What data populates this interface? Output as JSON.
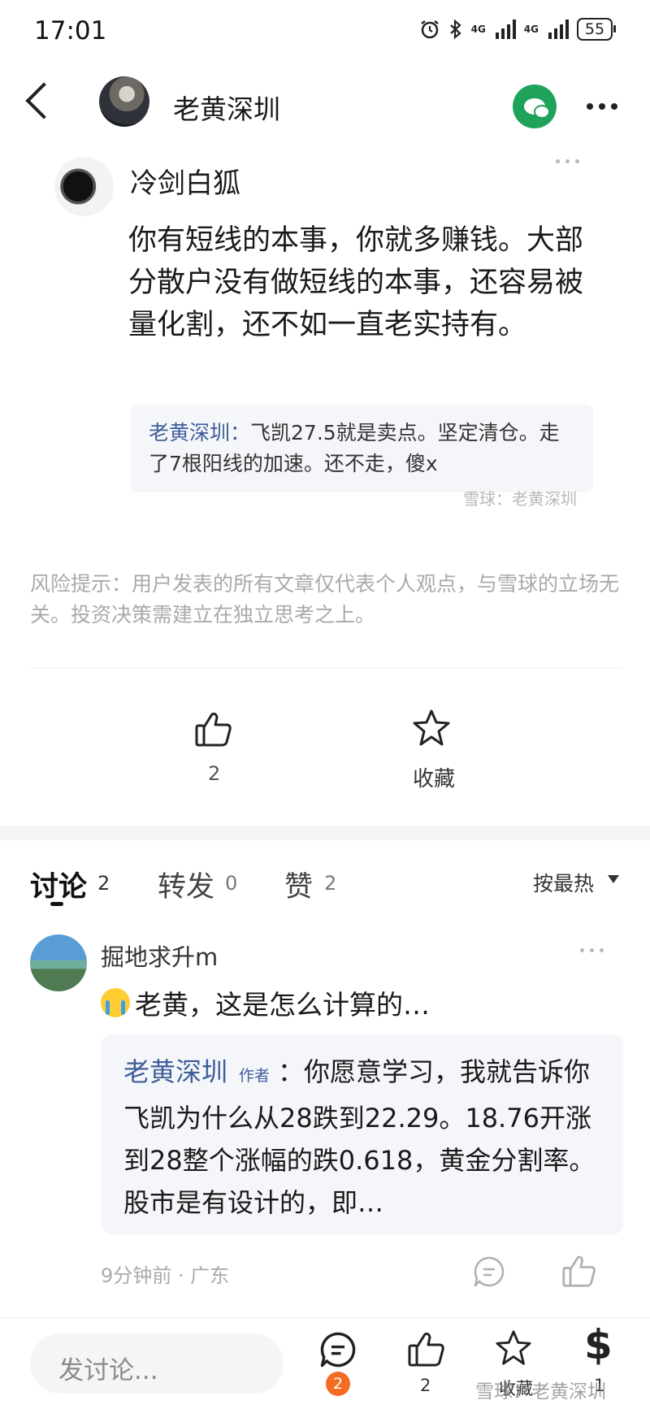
{
  "status_bar": {
    "time": "17:01",
    "network_1": "4G",
    "network_2": "4G",
    "battery": "55"
  },
  "header": {
    "author_name": "老黄深圳"
  },
  "quoted_post": {
    "user": "冷剑白狐",
    "text": "你有短线的本事，你就多赚钱。大部分散户没有做短线的本事，还容易被量化割，还不如一直老实持有。",
    "quote_name": "老黄深圳：",
    "quote_text": "飞凯27.5就是卖点。坚定清仓。走了7根阳线的加速。还不走，傻x"
  },
  "watermark": "雪球：老黄深圳",
  "risk_notice": "风险提示：用户发表的所有文章仅代表个人观点，与雪球的立场无关。投资决策需建立在独立思考之上。",
  "actions": {
    "like_count": "2",
    "favorite_label": "收藏"
  },
  "tabs": {
    "discussion_label": "讨论",
    "discussion_count": "2",
    "repost_label": "转发",
    "repost_count": "0",
    "like_label": "赞",
    "like_count": "2",
    "sort_label": "按最热"
  },
  "comment": {
    "user": "掘地求升m",
    "text": "老黄，这是怎么计算的…",
    "reply_name": "老黄深圳",
    "author_tag": "作者",
    "reply_text": "：你愿意学习，我就告诉你飞凯为什么从28跌到22.29。18.76开涨到28整个涨幅的跌0.618，黄金分割率。股市是有设计的，即…",
    "meta": "9分钟前 · 广东"
  },
  "bottom_bar": {
    "input_placeholder": "发讨论...",
    "comment_badge": "2",
    "like_count": "2",
    "favorite_label": "收藏",
    "reward_count": "1"
  },
  "colors": {
    "accent_blue": "#3e5e99",
    "wechat_green": "#1fa35b",
    "badge_orange": "#f36c21"
  }
}
